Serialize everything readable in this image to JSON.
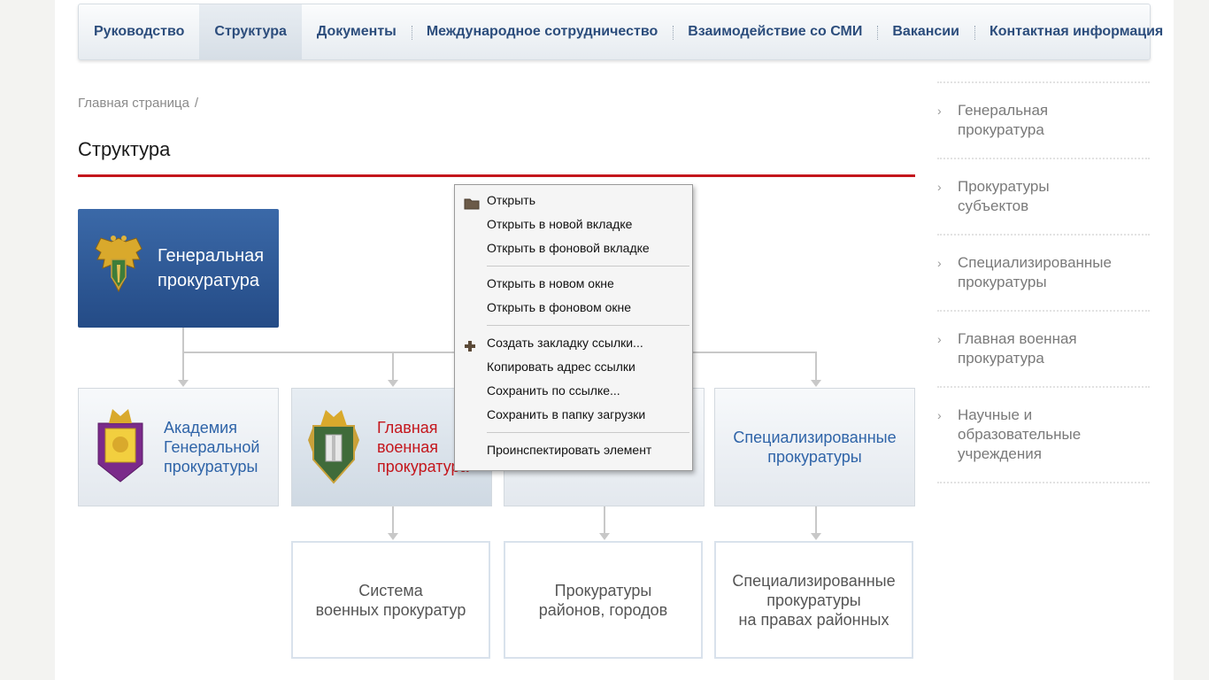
{
  "nav": {
    "items": [
      {
        "label": "Руководство"
      },
      {
        "label": "Структура"
      },
      {
        "label": "Документы"
      },
      {
        "label": "Международное сотрудничество"
      },
      {
        "label": "Взаимодействие со СМИ"
      },
      {
        "label": "Вакансии"
      },
      {
        "label": "Контактная информация"
      }
    ],
    "active": "Структура"
  },
  "breadcrumb": {
    "home": "Главная страница",
    "separator": "/"
  },
  "page_title": "Структура",
  "org": {
    "main": {
      "line1": "Генеральная",
      "line2": "прокуратура"
    },
    "academy": {
      "line1": "Академия",
      "line2": "Генеральной",
      "line3": "прокуратуры"
    },
    "military": {
      "line1": "Главная",
      "line2": "военная",
      "line3": "прокуратура"
    },
    "specialized": {
      "line1": "Специализированные",
      "line2": "прокуратуры"
    },
    "military_system": {
      "line1": "Система",
      "line2": "военных прокуратур"
    },
    "district": {
      "line1": "Прокуратуры",
      "line2": "районов, городов"
    },
    "specialized_district": {
      "line1": "Специализированные",
      "line2": "прокуратуры",
      "line3": "на правах районных"
    }
  },
  "sidebar": {
    "items": [
      {
        "line1": "Генеральная",
        "line2": "прокуратура"
      },
      {
        "line1": "Прокуратуры",
        "line2": "субъектов"
      },
      {
        "line1": "Специализированные",
        "line2": "прокуратуры"
      },
      {
        "line1": "Главная военная",
        "line2": "прокуратура"
      },
      {
        "line1": "Научные и",
        "line2": "образовательные",
        "line3": "учреждения"
      }
    ]
  },
  "context_menu": {
    "open": "Открыть",
    "open_new_tab": "Открыть в новой вкладке",
    "open_bg_tab": "Открыть в фоновой вкладке",
    "open_new_window": "Открыть в новом окне",
    "open_bg_window": "Открыть в фоновом окне",
    "bookmark": "Создать закладку ссылки...",
    "copy_link": "Копировать адрес ссылки",
    "save_link": "Сохранить по ссылке...",
    "save_downloads": "Сохранить в папку загрузки",
    "inspect": "Проинспектировать элемент"
  },
  "colors": {
    "nav_text": "#2c4d7c",
    "main_box": "#2e5a98",
    "accent_red": "#c4161c",
    "link_blue": "#2f64a8"
  }
}
